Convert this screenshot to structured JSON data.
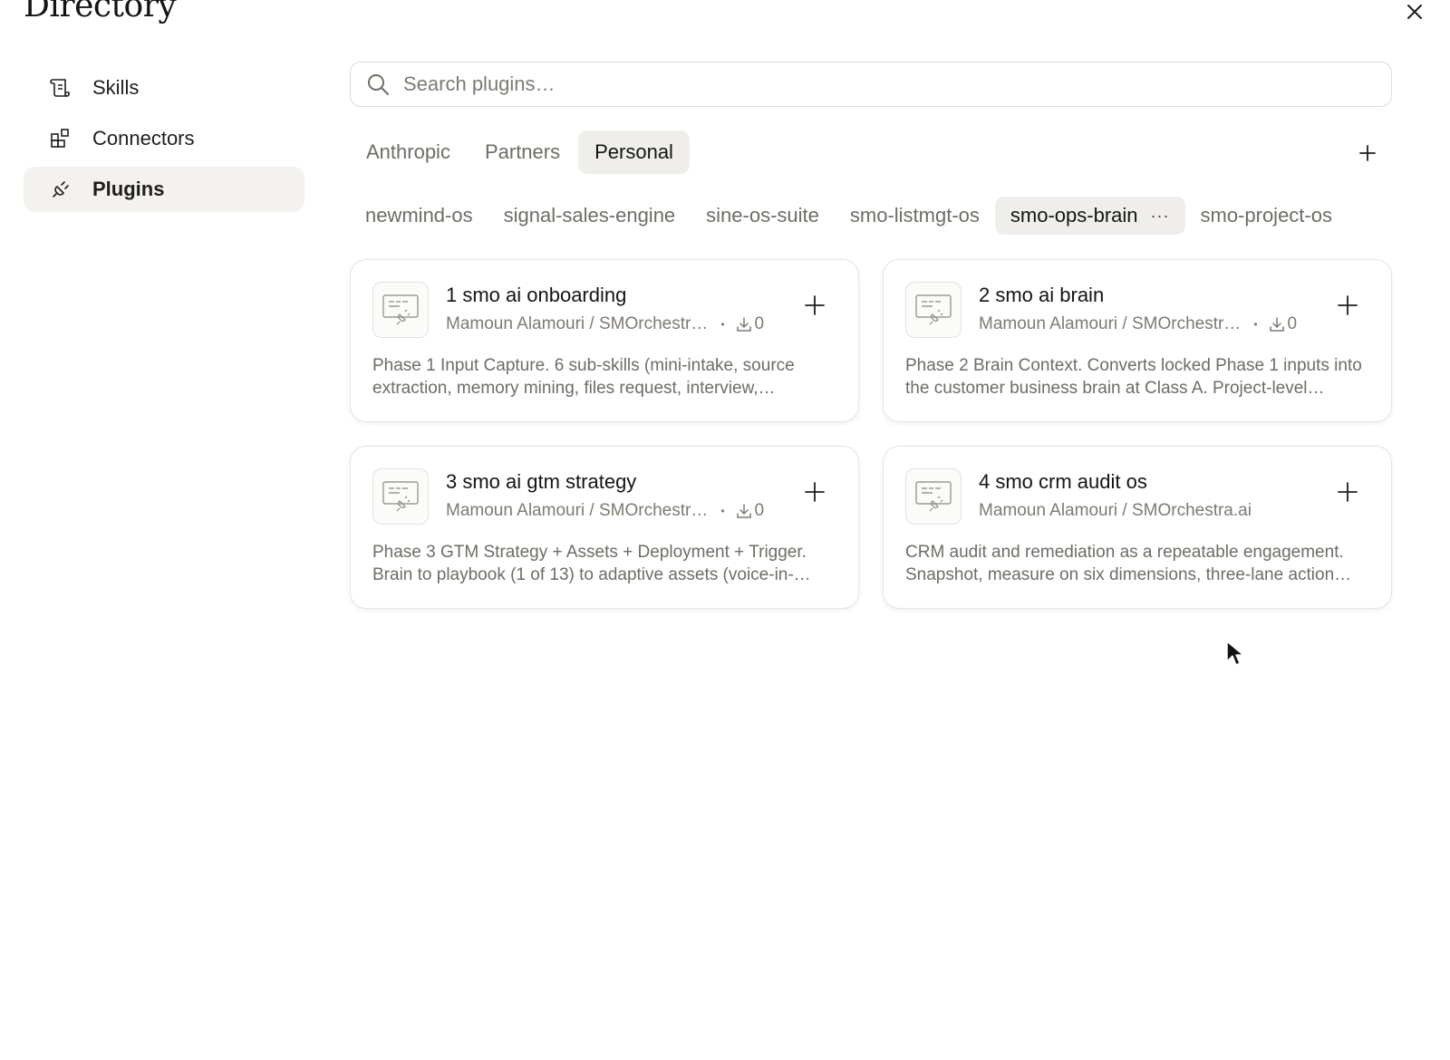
{
  "header": {
    "title": "Directory"
  },
  "sidebar": {
    "items": [
      {
        "label": "Skills",
        "icon": "scroll-icon",
        "active": false
      },
      {
        "label": "Connectors",
        "icon": "grid-plus-icon",
        "active": false
      },
      {
        "label": "Plugins",
        "icon": "plug-icon",
        "active": true
      }
    ]
  },
  "search": {
    "placeholder": "Search plugins…",
    "value": ""
  },
  "tabs": [
    {
      "label": "Anthropic",
      "active": false
    },
    {
      "label": "Partners",
      "active": false
    },
    {
      "label": "Personal",
      "active": true
    }
  ],
  "collections": [
    {
      "label": "newmind-os",
      "active": false
    },
    {
      "label": "signal-sales-engine",
      "active": false
    },
    {
      "label": "sine-os-suite",
      "active": false
    },
    {
      "label": "smo-listmgt-os",
      "active": false
    },
    {
      "label": "smo-ops-brain",
      "active": true,
      "more": "···"
    },
    {
      "label": "smo-project-os",
      "active": false
    }
  ],
  "cards": [
    {
      "name": "1 smo ai onboarding",
      "author": "Mamoun Alamouri / SMOrchestr…",
      "dot": "•",
      "downloads": "0",
      "description": "Phase 1 Input Capture. 6 sub-skills (mini-intake, source extraction, memory mining, files request, interview,…"
    },
    {
      "name": "2 smo ai brain",
      "author": "Mamoun Alamouri / SMOrchestr…",
      "dot": "•",
      "downloads": "0",
      "description": "Phase 2 Brain Context. Converts locked Phase 1 inputs into the customer business brain at Class A. Project-level…"
    },
    {
      "name": "3 smo ai gtm strategy",
      "author": "Mamoun Alamouri / SMOrchestr…",
      "dot": "•",
      "downloads": "0",
      "description": "Phase 3 GTM Strategy + Assets + Deployment + Trigger. Brain to playbook (1 of 13) to adaptive assets (voice-in-…"
    },
    {
      "name": "4 smo crm audit os",
      "author": "Mamoun Alamouri / SMOrchestra.ai",
      "description": "CRM audit and remediation as a repeatable engagement. Snapshot, measure on six dimensions, three-lane action…"
    }
  ],
  "colors": {
    "active_bg": "#efeeea",
    "text": "#141413",
    "muted": "#6f6c65"
  }
}
